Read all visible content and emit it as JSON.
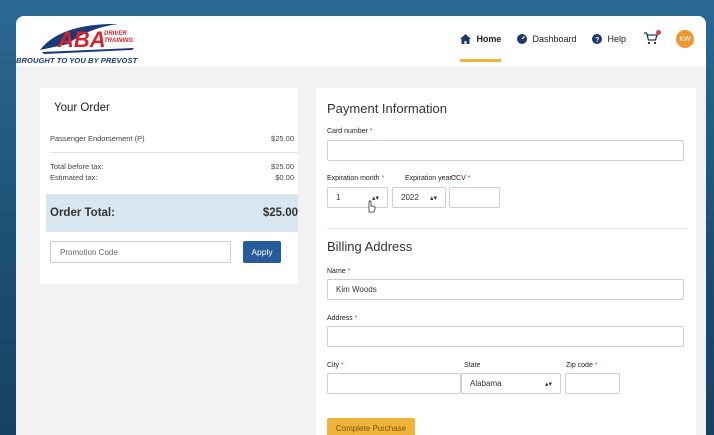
{
  "header": {
    "logo_text": "ABA",
    "logo_subtext": "DRIVER TRAINING",
    "tagline": "BROUGHT TO YOU BY PREVOST",
    "nav": [
      {
        "label": "Home",
        "icon": "home-icon",
        "active": true
      },
      {
        "label": "Dashboard",
        "icon": "dashboard-icon",
        "active": false
      },
      {
        "label": "Help",
        "icon": "help-icon",
        "active": false
      }
    ],
    "avatar_initials": "KW"
  },
  "order": {
    "title": "Your Order",
    "item_label": "Passenger Endorsement (P)",
    "item_price": "$25.00",
    "total_before_tax_label": "Total before tax:",
    "total_before_tax_value": "$25.00",
    "estimated_tax_label": "Estimated tax:",
    "estimated_tax_value": "$0.00",
    "order_total_label": "Order Total:",
    "order_total_value": "$25.00",
    "promo_placeholder": "Promotion Code",
    "apply_label": "Apply"
  },
  "payment": {
    "title": "Payment Information",
    "card_number_label": "Card number",
    "card_number_value": "",
    "exp_month_label": "Expiration month",
    "exp_month_value": "1",
    "exp_year_label": "Expiration year",
    "exp_year_value": "2022",
    "ccv_label": "CCV",
    "ccv_value": "",
    "required_mark": "*"
  },
  "billing": {
    "title": "Billing Address",
    "name_label": "Name",
    "name_value": "Kim Woods",
    "address_label": "Address",
    "address_value": "",
    "city_label": "City",
    "city_value": "",
    "state_label": "State",
    "state_value": "Alabama",
    "zip_label": "Zip code",
    "zip_value": "",
    "complete_label": "Complete Purchase"
  },
  "colors": {
    "accent_yellow": "#f0b43a",
    "primary_blue": "#275b9c",
    "total_bg": "#d9e6ef",
    "brand_red": "#d8232a"
  }
}
